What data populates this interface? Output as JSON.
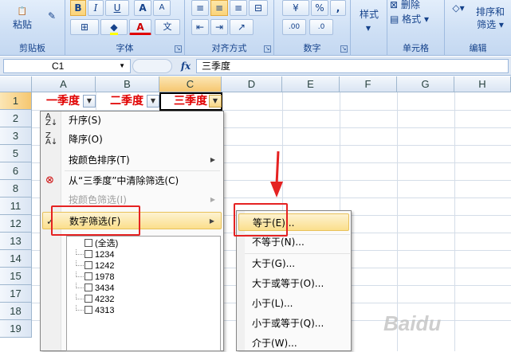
{
  "ribbon": {
    "paste_label": "粘贴",
    "clipboard_label": "剪贴板",
    "font_group_label": "字体",
    "align_group_label": "对齐方式",
    "number_group_label": "数字",
    "style_label": "样式",
    "cells_group_label": "单元格",
    "delete_label": "删除",
    "format_label": "格式",
    "sort_filter_label": "排序和",
    "filter_label": "筛选",
    "edit_group_label": "编辑",
    "bold": "B",
    "italic": "I",
    "underline": "U",
    "grow_font": "A",
    "shrink_font": "A",
    "font_color": "A",
    "wen_label": "文",
    "percent": "%",
    "comma": ",",
    "dec_inc": ".00",
    "dec_dec": ".0"
  },
  "formula_bar": {
    "cell_ref": "C1",
    "fx": "fx",
    "content": "三季度"
  },
  "grid": {
    "columns": [
      "A",
      "B",
      "C",
      "D",
      "E",
      "F",
      "G",
      "H"
    ],
    "rows": [
      "1",
      "2",
      "3",
      "5",
      "6",
      "8",
      "11",
      "12",
      "13",
      "14",
      "15",
      "17",
      "18",
      "19"
    ],
    "a1": "一季度",
    "b1": "二季度",
    "c1": "三季度"
  },
  "filter_menu": {
    "sort_asc": "升序(S)",
    "sort_desc": "降序(O)",
    "sort_by_color": "按颜色排序(T)",
    "clear_filter": "从“三季度”中清除筛选(C)",
    "filter_by_color": "按颜色筛选(I)",
    "number_filter": "数字筛选(F)",
    "list": [
      "(全选)",
      "1234",
      "1242",
      "1978",
      "3434",
      "4232",
      "4313"
    ]
  },
  "submenu": {
    "items": [
      "等于(E)...",
      "不等于(N)...",
      "大于(G)...",
      "大于或等于(O)...",
      "小于(L)...",
      "小于或等于(Q)...",
      "介于(W)..."
    ]
  },
  "colors": {
    "header_text": "#e00000",
    "annotation": "#e52222",
    "highlight": "#fbdf8c"
  }
}
